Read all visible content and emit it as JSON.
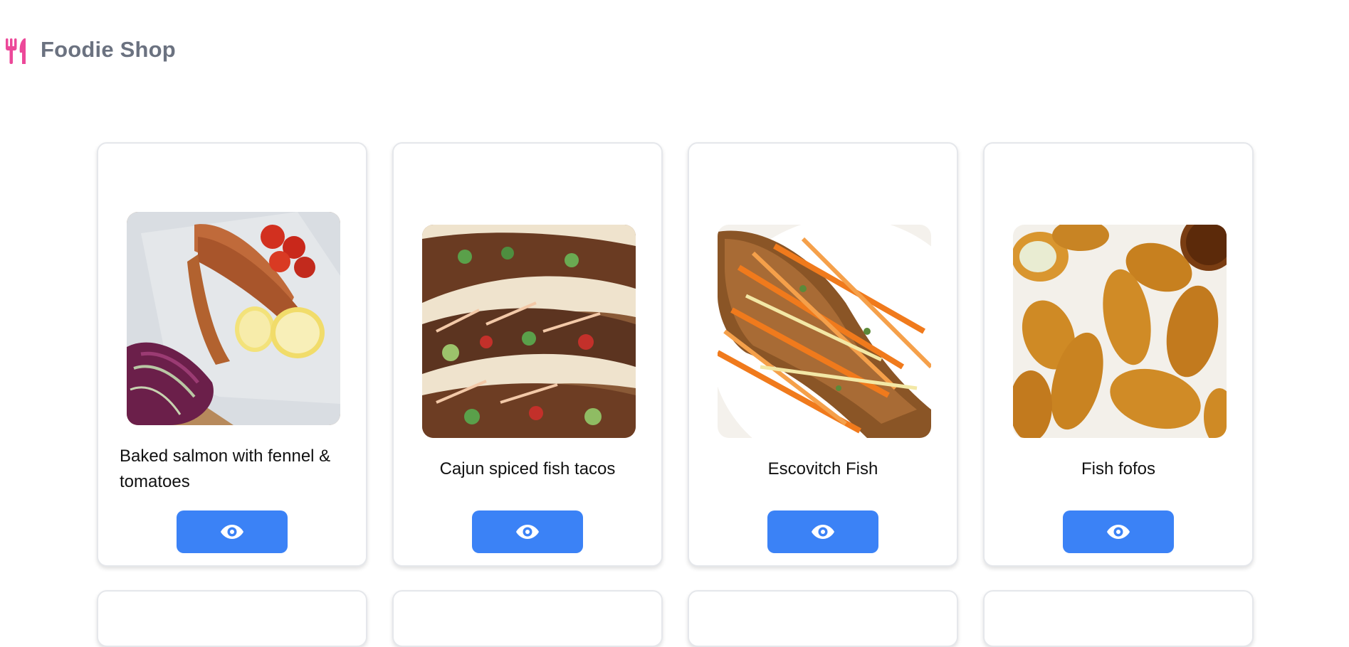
{
  "header": {
    "brand": "Foodie Shop",
    "logo_icon": "utensils-icon",
    "logo_color": "#ec4899"
  },
  "products": [
    {
      "title": "Baked salmon with fennel & tomatoes",
      "image": "baked-salmon-image",
      "button_icon": "eye-icon"
    },
    {
      "title": "Cajun spiced fish tacos",
      "image": "fish-tacos-image",
      "button_icon": "eye-icon"
    },
    {
      "title": "Escovitch Fish",
      "image": "escovitch-fish-image",
      "button_icon": "eye-icon"
    },
    {
      "title": "Fish fofos",
      "image": "fish-fofos-image",
      "button_icon": "eye-icon"
    }
  ],
  "colors": {
    "accent": "#3b82f6",
    "brand_text": "#6b7280",
    "card_border": "#e5e7eb"
  }
}
